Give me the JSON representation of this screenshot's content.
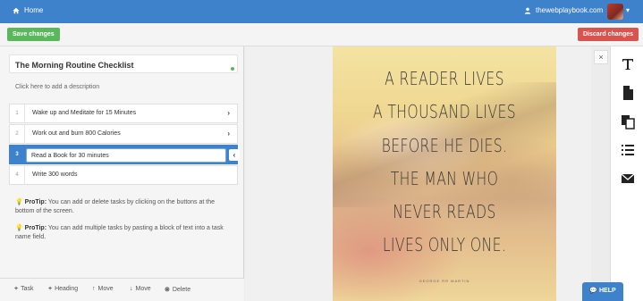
{
  "topbar": {
    "home_label": "Home",
    "site_label": "thewebplaybook.com"
  },
  "toolbar": {
    "save_label": "Save changes",
    "discard_label": "Discard changes"
  },
  "checklist": {
    "title": "The Morning Routine Checklist",
    "description_placeholder": "Click here to add a description",
    "items": [
      {
        "number": "1",
        "text": "Wake up and Meditate for 15 Minutes"
      },
      {
        "number": "2",
        "text": "Work out and burn 800 Calories"
      },
      {
        "number": "3",
        "text": "Read a Book for 30 minutes"
      },
      {
        "number": "4",
        "text": "Write 300 words"
      }
    ],
    "active_index": 2,
    "tips": [
      {
        "label": "ProTip:",
        "text": " You can add or delete tasks by clicking on the buttons at the bottom of the screen."
      },
      {
        "label": "ProTip:",
        "text": " You can add multiple tasks by pasting a block of text into a task name field."
      }
    ]
  },
  "bottombar": {
    "task": "Task",
    "heading": "Heading",
    "move_up": "Move",
    "move_down": "Move",
    "delete": "Delete"
  },
  "poster": {
    "lines": [
      "A READER LIVES",
      "A THOUSAND LIVES",
      "BEFORE HE DIES.",
      "THE MAN WHO",
      "NEVER READS",
      "LIVES ONLY ONE."
    ],
    "author": "GEORGE RR MARTIN"
  },
  "close_label": "×",
  "help_label": "HELP",
  "colors": {
    "brand_blue": "#3e82cb",
    "save_green": "#5bb75b",
    "discard_red": "#d9534f"
  },
  "icons": {
    "home": "home-icon",
    "user": "user-icon",
    "text_tool": "text-icon",
    "document": "document-icon",
    "copy": "copy-icon",
    "list": "list-icon",
    "email": "envelope-icon"
  }
}
